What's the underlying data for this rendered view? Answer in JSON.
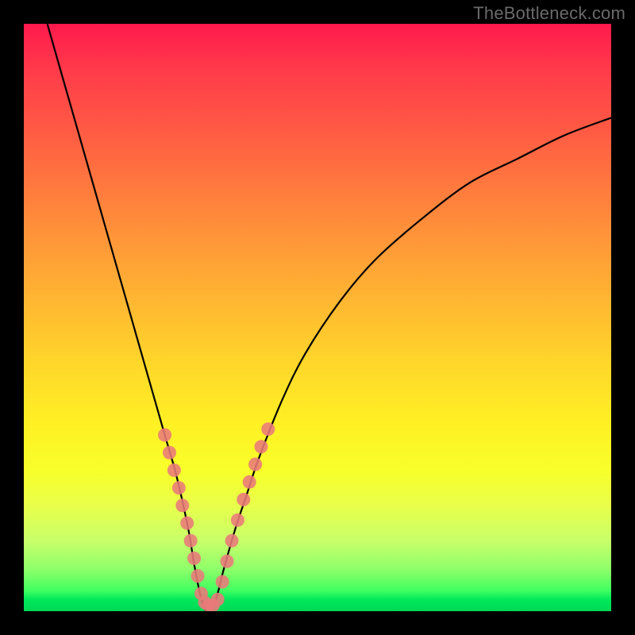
{
  "watermark": "TheBottleneck.com",
  "chart_data": {
    "type": "line",
    "title": "",
    "xlabel": "",
    "ylabel": "",
    "xlim": [
      0,
      100
    ],
    "ylim": [
      0,
      100
    ],
    "grid": false,
    "legend": null,
    "series": [
      {
        "name": "bottleneck-curve",
        "x": [
          4,
          8,
          12,
          16,
          20,
          22,
          24,
          26,
          28,
          29,
          30,
          31,
          32,
          33,
          34,
          36,
          38,
          40,
          44,
          48,
          54,
          60,
          68,
          76,
          84,
          92,
          100
        ],
        "y": [
          100,
          86,
          72,
          58,
          44,
          37,
          30,
          23,
          14,
          8,
          3,
          0,
          0,
          3,
          7,
          14,
          20,
          26,
          36,
          44,
          53,
          60,
          67,
          73,
          77,
          81,
          84
        ]
      }
    ],
    "markers": {
      "name": "highlighted-points",
      "color": "#e97a7a",
      "points": [
        {
          "x": 24.0,
          "y": 30.0
        },
        {
          "x": 24.8,
          "y": 27.0
        },
        {
          "x": 25.6,
          "y": 24.0
        },
        {
          "x": 26.4,
          "y": 21.0
        },
        {
          "x": 27.0,
          "y": 18.0
        },
        {
          "x": 27.8,
          "y": 15.0
        },
        {
          "x": 28.4,
          "y": 12.0
        },
        {
          "x": 29.0,
          "y": 9.0
        },
        {
          "x": 29.6,
          "y": 6.0
        },
        {
          "x": 30.2,
          "y": 3.0
        },
        {
          "x": 30.8,
          "y": 1.5
        },
        {
          "x": 31.5,
          "y": 1.0
        },
        {
          "x": 32.2,
          "y": 1.0
        },
        {
          "x": 33.0,
          "y": 2.0
        },
        {
          "x": 33.8,
          "y": 5.0
        },
        {
          "x": 34.6,
          "y": 8.5
        },
        {
          "x": 35.4,
          "y": 12.0
        },
        {
          "x": 36.4,
          "y": 15.5
        },
        {
          "x": 37.4,
          "y": 19.0
        },
        {
          "x": 38.4,
          "y": 22.0
        },
        {
          "x": 39.4,
          "y": 25.0
        },
        {
          "x": 40.4,
          "y": 28.0
        },
        {
          "x": 41.6,
          "y": 31.0
        }
      ]
    },
    "colors": {
      "curve": "#000000",
      "marker": "#e97a7a",
      "frame": "#000000",
      "gradient_top": "#ff1a4d",
      "gradient_bottom": "#00d856"
    }
  }
}
